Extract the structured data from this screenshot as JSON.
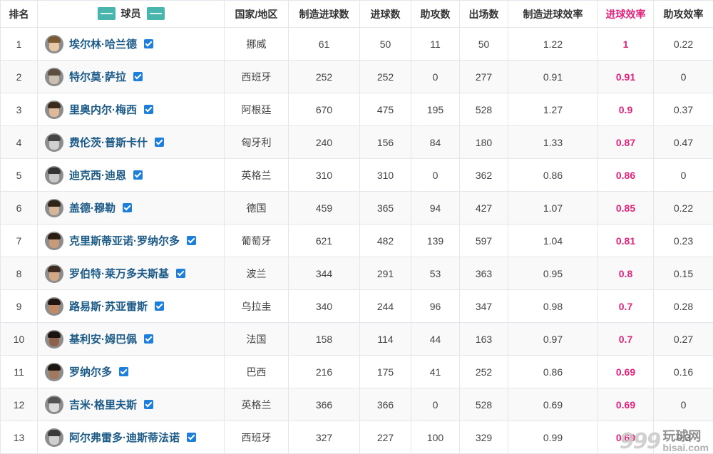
{
  "header": {
    "rank": "排名",
    "player": "球员",
    "country": "国家/地区",
    "created_goals": "制造进球数",
    "goals": "进球数",
    "assists": "助攻数",
    "appearances": "出场数",
    "created_eff": "制造进球效率",
    "goal_eff": "进球效率",
    "assist_eff": "助攻效率"
  },
  "colors": {
    "highlight": "#e2237b",
    "player_name": "#1c5b88",
    "verified": "#1d7fd9",
    "logo": "#48b6ac"
  },
  "rows": [
    {
      "rank": "1",
      "name": "埃尔林·哈兰德",
      "country": "挪威",
      "created": "61",
      "goals": "50",
      "assists": "11",
      "apps": "50",
      "created_eff": "1.22",
      "goal_eff": "1",
      "assist_eff": "0.22"
    },
    {
      "rank": "2",
      "name": "特尔莫·萨拉",
      "country": "西班牙",
      "created": "252",
      "goals": "252",
      "assists": "0",
      "apps": "277",
      "created_eff": "0.91",
      "goal_eff": "0.91",
      "assist_eff": "0"
    },
    {
      "rank": "3",
      "name": "里奥内尔·梅西",
      "country": "阿根廷",
      "created": "670",
      "goals": "475",
      "assists": "195",
      "apps": "528",
      "created_eff": "1.27",
      "goal_eff": "0.9",
      "assist_eff": "0.37"
    },
    {
      "rank": "4",
      "name": "费伦茨·普斯卡什",
      "country": "匈牙利",
      "created": "240",
      "goals": "156",
      "assists": "84",
      "apps": "180",
      "created_eff": "1.33",
      "goal_eff": "0.87",
      "assist_eff": "0.47"
    },
    {
      "rank": "5",
      "name": "迪克西·迪恩",
      "country": "英格兰",
      "created": "310",
      "goals": "310",
      "assists": "0",
      "apps": "362",
      "created_eff": "0.86",
      "goal_eff": "0.86",
      "assist_eff": "0"
    },
    {
      "rank": "6",
      "name": "盖德·穆勒",
      "country": "德国",
      "created": "459",
      "goals": "365",
      "assists": "94",
      "apps": "427",
      "created_eff": "1.07",
      "goal_eff": "0.85",
      "assist_eff": "0.22"
    },
    {
      "rank": "7",
      "name": "克里斯蒂亚诺·罗纳尔多",
      "country": "葡萄牙",
      "created": "621",
      "goals": "482",
      "assists": "139",
      "apps": "597",
      "created_eff": "1.04",
      "goal_eff": "0.81",
      "assist_eff": "0.23"
    },
    {
      "rank": "8",
      "name": "罗伯特·莱万多夫斯基",
      "country": "波兰",
      "created": "344",
      "goals": "291",
      "assists": "53",
      "apps": "363",
      "created_eff": "0.95",
      "goal_eff": "0.8",
      "assist_eff": "0.15"
    },
    {
      "rank": "9",
      "name": "路易斯·苏亚雷斯",
      "country": "乌拉圭",
      "created": "340",
      "goals": "244",
      "assists": "96",
      "apps": "347",
      "created_eff": "0.98",
      "goal_eff": "0.7",
      "assist_eff": "0.28"
    },
    {
      "rank": "10",
      "name": "基利安·姆巴佩",
      "country": "法国",
      "created": "158",
      "goals": "114",
      "assists": "44",
      "apps": "163",
      "created_eff": "0.97",
      "goal_eff": "0.7",
      "assist_eff": "0.27"
    },
    {
      "rank": "11",
      "name": "罗纳尔多",
      "country": "巴西",
      "created": "216",
      "goals": "175",
      "assists": "41",
      "apps": "252",
      "created_eff": "0.86",
      "goal_eff": "0.69",
      "assist_eff": "0.16"
    },
    {
      "rank": "12",
      "name": "吉米·格里夫斯",
      "country": "英格兰",
      "created": "366",
      "goals": "366",
      "assists": "0",
      "apps": "528",
      "created_eff": "0.69",
      "goal_eff": "0.69",
      "assist_eff": "0"
    },
    {
      "rank": "13",
      "name": "阿尔弗雷多·迪斯蒂法诺",
      "country": "西班牙",
      "created": "327",
      "goals": "227",
      "assists": "100",
      "apps": "329",
      "created_eff": "0.99",
      "goal_eff": "0.69",
      "assist_eff": "0.3"
    }
  ],
  "watermark": {
    "number": "999",
    "cn": "玩球网",
    "en": "bisai.com"
  }
}
